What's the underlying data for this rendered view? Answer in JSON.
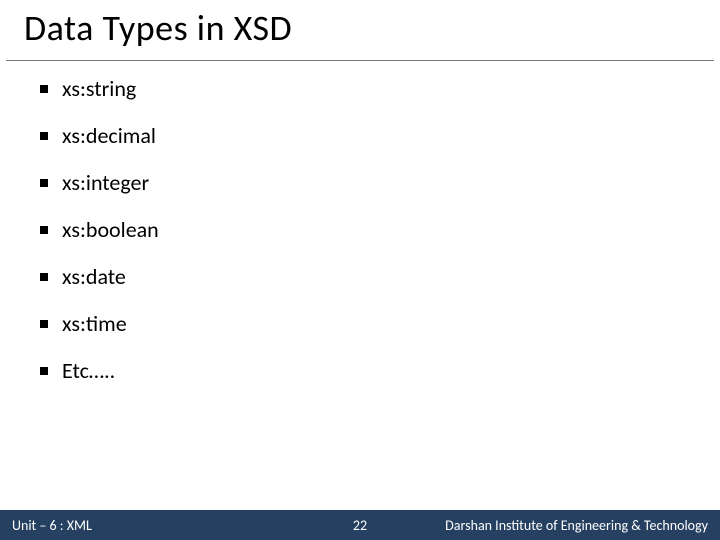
{
  "title": "Data Types in XSD",
  "items": [
    "xs:string",
    "xs:decimal",
    "xs:integer",
    "xs:boolean",
    "xs:date",
    "xs:time",
    "Etc….."
  ],
  "footer": {
    "left": "Unit – 6 : XML",
    "center": "22",
    "right": "Darshan Institute of Engineering & Technology"
  }
}
